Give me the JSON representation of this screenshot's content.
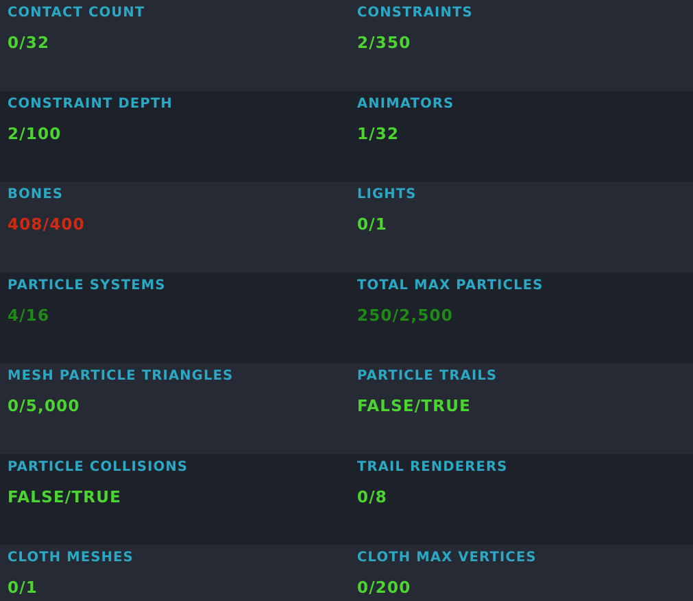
{
  "colors": {
    "label": "#2aa8c4",
    "ok": "#4cd531",
    "warn": "#1f8a16",
    "error": "#d22a12",
    "row_light": "#262a34",
    "row_dark": "#1d212a"
  },
  "stats": [
    {
      "label": "CONTACT COUNT",
      "value": "0/32",
      "status": "ok"
    },
    {
      "label": "CONSTRAINTS",
      "value": "2/350",
      "status": "ok"
    },
    {
      "label": "CONSTRAINT DEPTH",
      "value": "2/100",
      "status": "ok"
    },
    {
      "label": "ANIMATORS",
      "value": "1/32",
      "status": "ok"
    },
    {
      "label": "BONES",
      "value": "408/400",
      "status": "error"
    },
    {
      "label": "LIGHTS",
      "value": "0/1",
      "status": "ok"
    },
    {
      "label": "PARTICLE SYSTEMS",
      "value": "4/16",
      "status": "warn"
    },
    {
      "label": "TOTAL MAX PARTICLES",
      "value": "250/2,500",
      "status": "warn"
    },
    {
      "label": "MESH PARTICLE TRIANGLES",
      "value": "0/5,000",
      "status": "ok"
    },
    {
      "label": "PARTICLE TRAILS",
      "value": "FALSE/TRUE",
      "status": "ok"
    },
    {
      "label": "PARTICLE COLLISIONS",
      "value": "FALSE/TRUE",
      "status": "ok"
    },
    {
      "label": "TRAIL RENDERERS",
      "value": "0/8",
      "status": "ok"
    },
    {
      "label": "CLOTH MESHES",
      "value": "0/1",
      "status": "ok"
    },
    {
      "label": "CLOTH MAX VERTICES",
      "value": "0/200",
      "status": "ok"
    }
  ]
}
